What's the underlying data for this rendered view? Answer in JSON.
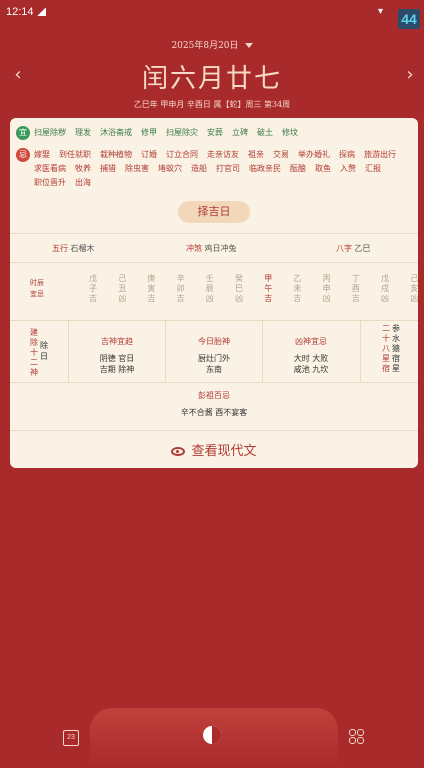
{
  "status_bar": {
    "time": "12:14",
    "badge": "44"
  },
  "header": {
    "date_selector": "2025年8月20日",
    "prev_icon": "chevron-left-icon",
    "next_icon": "chevron-right-icon",
    "lunar_date": "闰六月廿七",
    "ganzhi_line": "乙巳年 甲申月 辛酉日 属【蛇】周三 第34周"
  },
  "yi": {
    "icon_label": "宜",
    "items": [
      "扫屋除秽",
      "理发",
      "沐浴斋戒",
      "修甲",
      "扫屋除灾",
      "安葬",
      "立碑",
      "破土",
      "修坟"
    ]
  },
  "ji": {
    "icon_label": "忌",
    "items": [
      "嫁娶",
      "到任就职",
      "栽种植物",
      "订婚",
      "订立合同",
      "走亲访友",
      "祖亲",
      "交易",
      "举办婚礼",
      "探病",
      "旅游出行",
      "求医看病",
      "牧养",
      "捕猎",
      "除虫害",
      "堵蚁穴",
      "造船",
      "打官司",
      "临政亲民",
      "酝酿",
      "取鱼",
      "入赘",
      "汇报",
      "职位晋升",
      "出海"
    ]
  },
  "zeji_button": "择吉日",
  "info": {
    "wuxing_label": "五行",
    "wuxing_value": "石榴木",
    "chongsha_label": "冲煞",
    "chongsha_value": "鸡日冲兔",
    "bazi_label": "八字",
    "bazi_value": "乙巳"
  },
  "shichen": {
    "header": [
      "时辰",
      "宜忌"
    ],
    "columns": [
      {
        "stem": "戊",
        "branch": "子",
        "luck": "吉"
      },
      {
        "stem": "己",
        "branch": "丑",
        "luck": "凶"
      },
      {
        "stem": "庚",
        "branch": "寅",
        "luck": "吉"
      },
      {
        "stem": "辛",
        "branch": "卯",
        "luck": "吉"
      },
      {
        "stem": "壬",
        "branch": "辰",
        "luck": "凶"
      },
      {
        "stem": "癸",
        "branch": "巳",
        "luck": "凶"
      },
      {
        "stem": "甲",
        "branch": "午",
        "luck": "吉"
      },
      {
        "stem": "乙",
        "branch": "未",
        "luck": "吉"
      },
      {
        "stem": "丙",
        "branch": "申",
        "luck": "凶"
      },
      {
        "stem": "丁",
        "branch": "酉",
        "luck": "吉"
      },
      {
        "stem": "戊",
        "branch": "戌",
        "luck": "凶"
      },
      {
        "stem": "己",
        "branch": "亥",
        "luck": "凶"
      }
    ],
    "current_index": 6
  },
  "middle": {
    "jianchu_label": [
      "建",
      "除",
      "十",
      "二",
      "神"
    ],
    "jianchu_value": [
      "除",
      "日"
    ],
    "jishen_title": "吉神宜趋",
    "jishen_values": [
      "阴德 官日",
      "吉期 除神"
    ],
    "taishen_title": "今日胎神",
    "taishen_values": [
      "厨灶门外",
      "东南"
    ],
    "xiongshen_title": "凶神宜忌",
    "xiongshen_values": [
      "大时 大败",
      "咸池 九坎"
    ],
    "xiu_rows": [
      {
        "a": "二",
        "b": "参"
      },
      {
        "a": "十",
        "b": "水"
      },
      {
        "a": "八",
        "b": "猿"
      },
      {
        "a": "星",
        "b": "宿"
      },
      {
        "a": "宿",
        "b": "星"
      }
    ]
  },
  "pengzu": {
    "title": "彭祖百忌",
    "value": "辛不合酱 酉不宴客"
  },
  "modern_text_button": "查看现代文",
  "bottom_nav": {
    "calendar_icon_text": "23"
  }
}
